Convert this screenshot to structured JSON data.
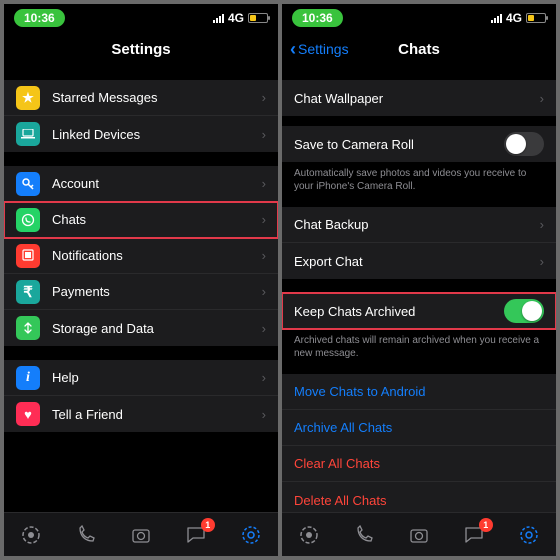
{
  "status": {
    "time": "10:36",
    "network": "4G"
  },
  "left": {
    "title": "Settings",
    "group1": [
      {
        "label": "Starred Messages",
        "iconColor": "#f5c518",
        "icon": "star"
      },
      {
        "label": "Linked Devices",
        "iconColor": "#1aa79c",
        "icon": "laptop"
      }
    ],
    "group2": [
      {
        "label": "Account",
        "iconColor": "#147efb",
        "icon": "key"
      },
      {
        "label": "Chats",
        "iconColor": "#25d366",
        "icon": "whatsapp",
        "highlight": true
      },
      {
        "label": "Notifications",
        "iconColor": "#ff3b30",
        "icon": "bell"
      },
      {
        "label": "Payments",
        "iconColor": "#1aa79c",
        "icon": "rupee"
      },
      {
        "label": "Storage and Data",
        "iconColor": "#34c759",
        "icon": "storage"
      }
    ],
    "group3": [
      {
        "label": "Help",
        "iconColor": "#147efb",
        "icon": "info"
      },
      {
        "label": "Tell a Friend",
        "iconColor": "#ff2d55",
        "icon": "heart"
      }
    ]
  },
  "right": {
    "back": "Settings",
    "title": "Chats",
    "row_wallpaper": "Chat Wallpaper",
    "row_save": "Save to Camera Roll",
    "save_toggle": false,
    "save_footer": "Automatically save photos and videos you receive to your iPhone's Camera Roll.",
    "row_backup": "Chat Backup",
    "row_export": "Export Chat",
    "row_archive": "Keep Chats Archived",
    "archive_toggle": true,
    "archive_footer": "Archived chats will remain archived when you receive a new message.",
    "action_move": "Move Chats to Android",
    "action_archive_all": "Archive All Chats",
    "action_clear": "Clear All Chats",
    "action_delete": "Delete All Chats"
  },
  "tabs": {
    "chats_badge": "1",
    "calls_badge": ""
  }
}
